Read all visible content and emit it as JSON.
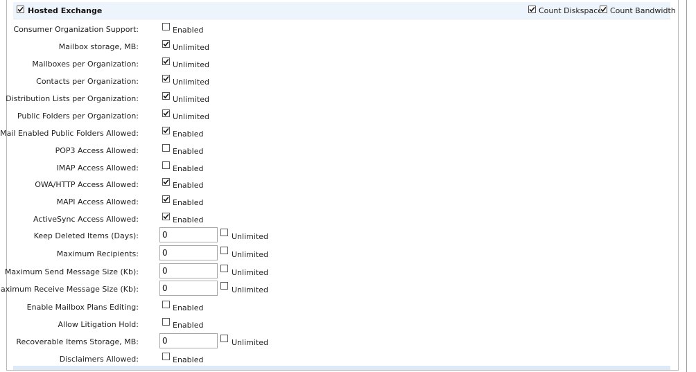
{
  "header": {
    "title": "Hosted Exchange",
    "title_checked": true,
    "count_diskspace_label": "Count Diskspace",
    "count_diskspace_checked": true,
    "count_bandwidth_label": "Count Bandwidth",
    "count_bandwidth_checked": true
  },
  "rows": [
    {
      "label": "Consumer Organization Support:",
      "type": "check",
      "checked": false,
      "option": "Enabled"
    },
    {
      "label": "Mailbox storage, MB:",
      "type": "check",
      "checked": true,
      "option": "Unlimited"
    },
    {
      "label": "Mailboxes per Organization:",
      "type": "check",
      "checked": true,
      "option": "Unlimited"
    },
    {
      "label": "Contacts per Organization:",
      "type": "check",
      "checked": true,
      "option": "Unlimited"
    },
    {
      "label": "Distribution Lists per Organization:",
      "type": "check",
      "checked": true,
      "option": "Unlimited"
    },
    {
      "label": "Public Folders per Organization:",
      "type": "check",
      "checked": true,
      "option": "Unlimited"
    },
    {
      "label": "Mail Enabled Public Folders Allowed:",
      "type": "check",
      "checked": true,
      "option": "Enabled"
    },
    {
      "label": "POP3 Access Allowed:",
      "type": "check",
      "checked": false,
      "option": "Enabled"
    },
    {
      "label": "IMAP Access Allowed:",
      "type": "check",
      "checked": false,
      "option": "Enabled"
    },
    {
      "label": "OWA/HTTP Access Allowed:",
      "type": "check",
      "checked": true,
      "option": "Enabled"
    },
    {
      "label": "MAPI Access Allowed:",
      "type": "check",
      "checked": true,
      "option": "Enabled"
    },
    {
      "label": "ActiveSync Access Allowed:",
      "type": "check",
      "checked": true,
      "option": "Enabled"
    },
    {
      "label": "Keep Deleted Items (Days):",
      "type": "input",
      "value": "0",
      "checked": false,
      "option": "Unlimited"
    },
    {
      "label": "Maximum Recipients:",
      "type": "input",
      "value": "0",
      "checked": false,
      "option": "Unlimited"
    },
    {
      "label": "Maximum Send Message Size (Kb):",
      "type": "input",
      "value": "0",
      "checked": false,
      "option": "Unlimited"
    },
    {
      "label": "Maximum Receive Message Size (Kb):",
      "type": "input",
      "value": "0",
      "checked": false,
      "option": "Unlimited"
    },
    {
      "label": "Enable Mailbox Plans Editing:",
      "type": "check",
      "checked": false,
      "option": "Enabled"
    },
    {
      "label": "Allow Litigation Hold:",
      "type": "check",
      "checked": false,
      "option": "Enabled"
    },
    {
      "label": "Recoverable Items Storage, MB:",
      "type": "input",
      "value": "0",
      "checked": false,
      "option": "Unlimited"
    },
    {
      "label": "Disclaimers Allowed:",
      "type": "check",
      "checked": false,
      "option": "Enabled"
    }
  ]
}
